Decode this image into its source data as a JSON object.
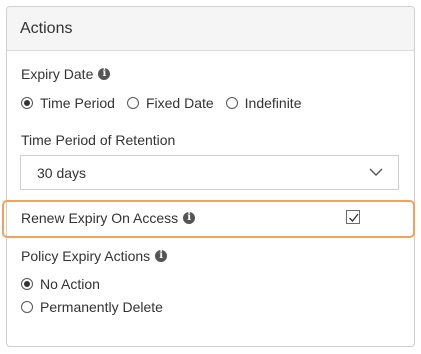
{
  "panel": {
    "title": "Actions"
  },
  "expiry_date": {
    "label": "Expiry Date",
    "options": [
      "Time Period",
      "Fixed Date",
      "Indefinite"
    ],
    "selected": "Time Period"
  },
  "retention": {
    "label": "Time Period of Retention",
    "selected_value": "30 days"
  },
  "renew": {
    "label": "Renew Expiry On Access",
    "checked": true,
    "highlight_color": "#f0a25e"
  },
  "policy_actions": {
    "label": "Policy Expiry Actions",
    "options": [
      "No Action",
      "Permanently Delete"
    ],
    "selected": "No Action"
  },
  "icons": {
    "info": "info-icon",
    "dropdown": "chevron-down-icon",
    "check": "checkmark-icon"
  }
}
